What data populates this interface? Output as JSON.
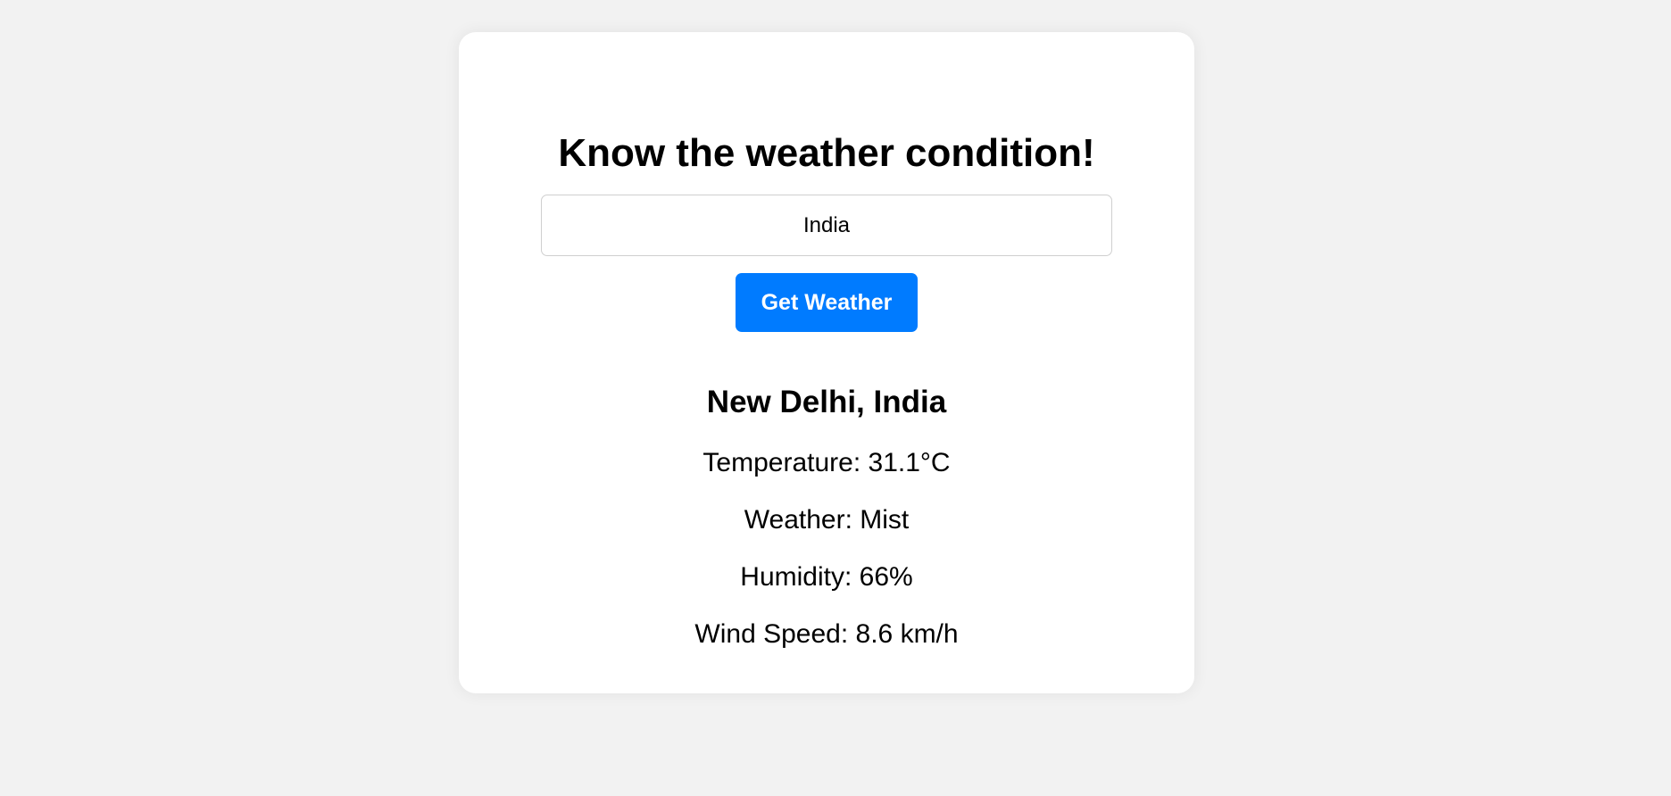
{
  "title": "Know the weather condition!",
  "search": {
    "value": "India",
    "placeholder": ""
  },
  "button": {
    "label": "Get Weather",
    "color": "#007bff"
  },
  "result": {
    "location": "New Delhi, India",
    "temperature": "Temperature: 31.1°C",
    "weather": "Weather: Mist",
    "humidity": "Humidity: 66%",
    "wind_speed": "Wind Speed: 8.6 km/h"
  }
}
